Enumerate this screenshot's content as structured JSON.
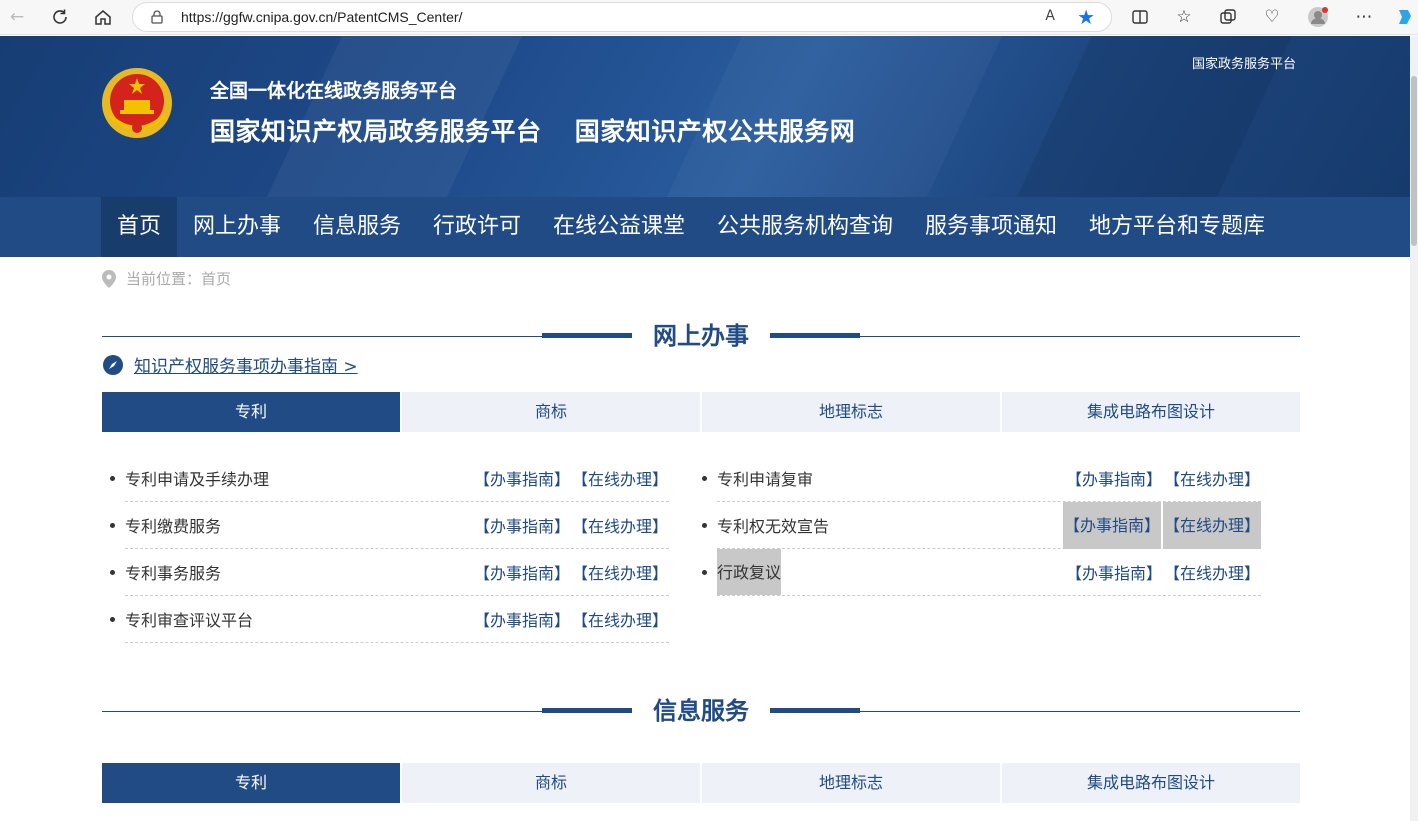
{
  "browser": {
    "url": "https://ggfw.cnipa.gov.cn/PatentCMS_Center/",
    "read_aloud": "A"
  },
  "header": {
    "subtitle": "全国一体化在线政务服务平台",
    "title_1": "国家知识产权局政务服务平台",
    "title_2": "国家知识产权公共服务网",
    "top_right_link": "国家政务服务平台"
  },
  "nav": {
    "items": [
      "首页",
      "网上办事",
      "信息服务",
      "行政许可",
      "在线公益课堂",
      "公共服务机构查询",
      "服务事项通知",
      "地方平台和专题库"
    ]
  },
  "breadcrumb": "当前位置：首页",
  "section_online": {
    "title": "网上办事",
    "guide_link": "知识产权服务事项办事指南 >",
    "tabs": [
      "专利",
      "商标",
      "地理标志",
      "集成电路布图设计"
    ],
    "left_items": [
      {
        "name": "专利申请及手续办理",
        "guide": "【办事指南】",
        "online": "【在线办理】"
      },
      {
        "name": "专利缴费服务",
        "guide": "【办事指南】",
        "online": "【在线办理】"
      },
      {
        "name": "专利事务服务",
        "guide": "【办事指南】",
        "online": "【在线办理】"
      },
      {
        "name": "专利审查评议平台",
        "guide": "【办事指南】",
        "online": "【在线办理】"
      }
    ],
    "right_items": [
      {
        "name": "专利申请复审",
        "guide": "【办事指南】",
        "online": "【在线办理】"
      },
      {
        "name": "专利权无效宣告",
        "guide": "【办事指南】",
        "online": "【在线办理】"
      },
      {
        "name": "行政复议",
        "guide": "【办事指南】",
        "online": "【在线办理】"
      }
    ]
  },
  "section_info": {
    "title": "信息服务",
    "tabs": [
      "专利",
      "商标",
      "地理标志",
      "集成电路布图设计"
    ]
  }
}
